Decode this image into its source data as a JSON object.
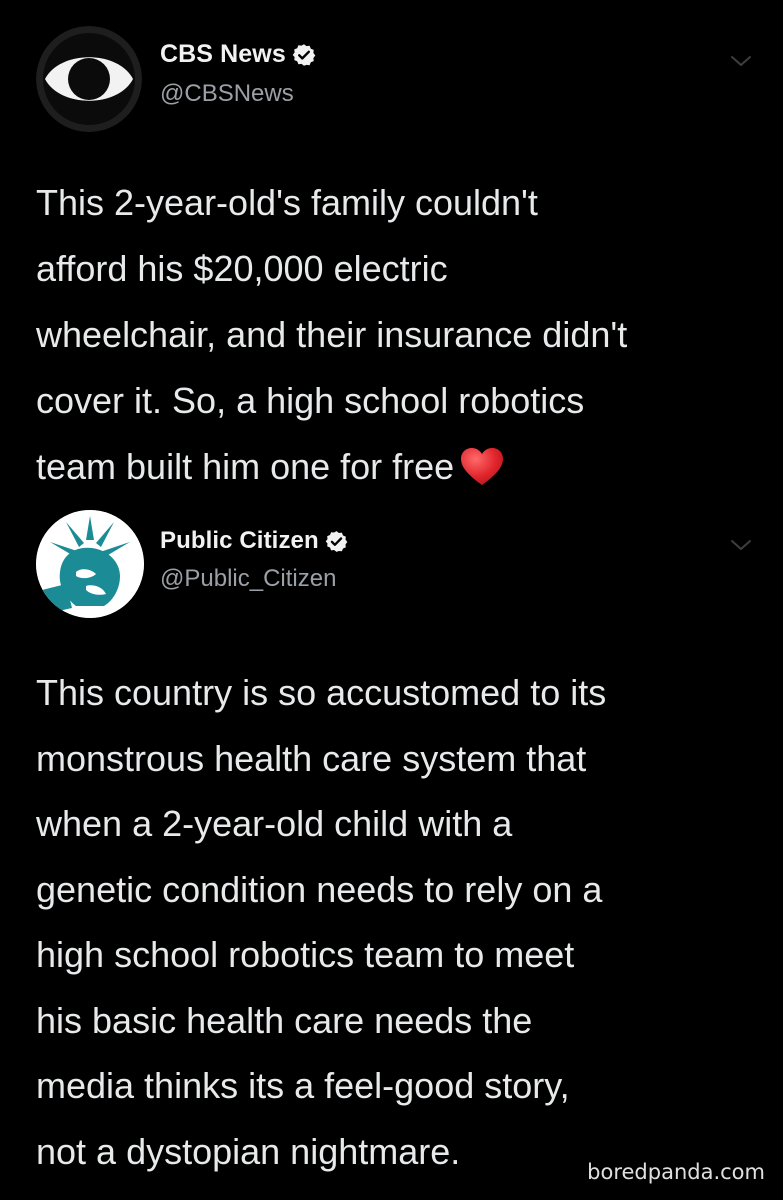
{
  "tweets": [
    {
      "display_name": "CBS News",
      "handle": "@CBSNews",
      "avatar_icon": "cbs-eye-logo-icon",
      "verified_icon": "verified-badge-icon",
      "menu_icon": "chevron-down-icon",
      "text": "This 2-year-old's family couldn't\nafford his $20,000 electric\nwheelchair, and their insurance didn't\ncover it. So, a high school robotics\nteam built him one for free",
      "emoji_icon": "red-heart-emoji-icon"
    },
    {
      "display_name": "Public Citizen",
      "handle": "@Public_Citizen",
      "avatar_icon": "statue-of-liberty-logo-icon",
      "verified_icon": "verified-badge-icon",
      "menu_icon": "chevron-down-icon",
      "text": "This country is so accustomed to its\nmonstrous health care system that\nwhen a 2-year-old child with a\ngenetic condition needs to rely on a\nhigh school robotics team to meet\nhis basic health care needs the\nmedia thinks its a feel-good story,\nnot a dystopian nightmare."
    }
  ],
  "watermark": "boredpanda.com",
  "colors": {
    "background": "#000000",
    "text": "#e7e9ea",
    "handle": "#9aa0a6",
    "heart": "#e0252c",
    "public_citizen_teal": "#1b8c95"
  }
}
